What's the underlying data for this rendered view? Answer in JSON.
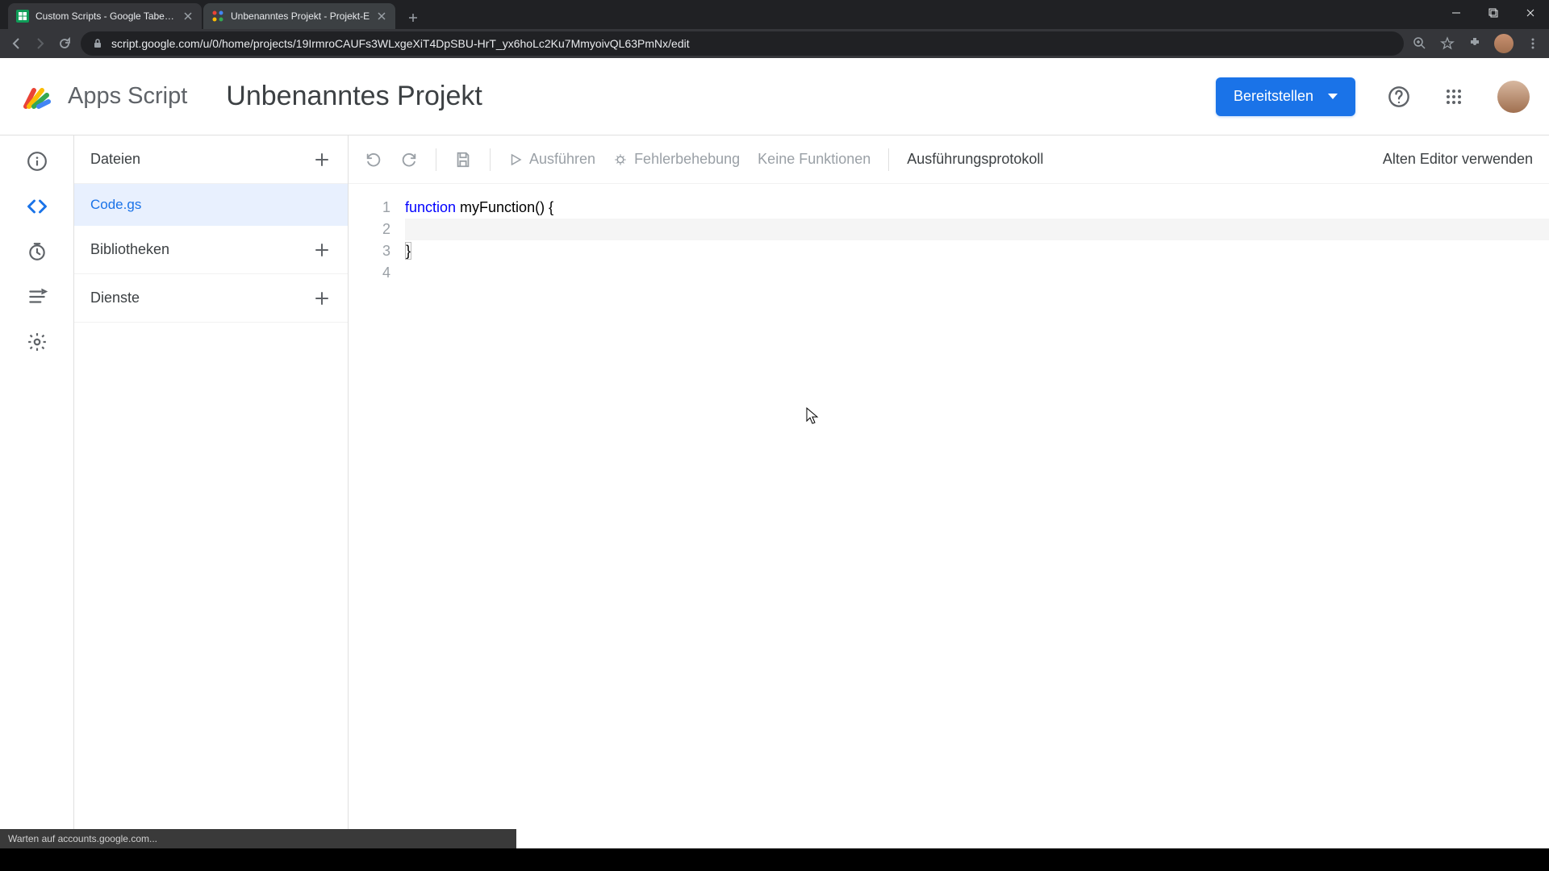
{
  "browser": {
    "tabs": [
      {
        "title": "Custom Scripts - Google Tabellen",
        "active": false
      },
      {
        "title": "Unbenanntes Projekt - Projekt-E",
        "active": true
      }
    ],
    "url": "script.google.com/u/0/home/projects/19IrmroCAUFs3WLxgeXiT4DpSBU-HrT_yx6hoLc2Ku7MmyoivQL63PmNx/edit"
  },
  "app": {
    "name": "Apps Script",
    "project_title": "Unbenanntes Projekt",
    "deploy_label": "Bereitstellen"
  },
  "sidebar": {
    "files_label": "Dateien",
    "libraries_label": "Bibliotheken",
    "services_label": "Dienste",
    "files": [
      {
        "name": "Code.gs",
        "active": true
      }
    ]
  },
  "toolbar": {
    "run_label": "Ausführen",
    "debug_label": "Fehlerbehebung",
    "no_functions": "Keine Funktionen",
    "exec_log": "Ausführungsprotokoll",
    "old_editor": "Alten Editor verwenden"
  },
  "code": {
    "lines": [
      {
        "n": 1,
        "keyword": "function",
        "rest": " myFunction() {"
      },
      {
        "n": 2,
        "keyword": "",
        "rest": "  "
      },
      {
        "n": 3,
        "keyword": "",
        "rest": "}"
      },
      {
        "n": 4,
        "keyword": "",
        "rest": ""
      }
    ]
  },
  "status": {
    "text": "Warten auf accounts.google.com..."
  },
  "colors": {
    "primary": "#1a73e8",
    "text_muted": "#5f6368"
  }
}
